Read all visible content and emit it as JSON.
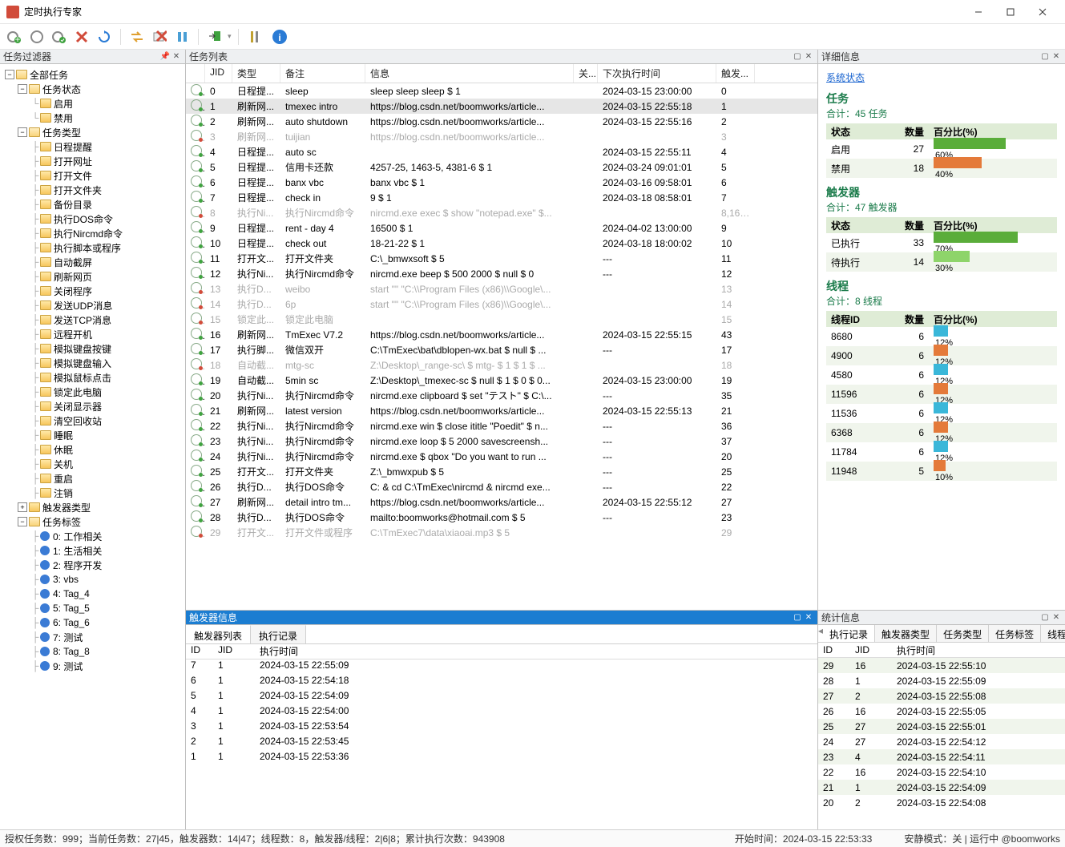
{
  "window": {
    "title": "定时执行专家"
  },
  "toolbar": {
    "info": "i"
  },
  "panels": {
    "filter": "任务过滤器",
    "tasklist": "任务列表",
    "trigger": "触发器信息",
    "detail": "详细信息",
    "stats": "统计信息"
  },
  "trigger_tabs": {
    "list": "触发器列表",
    "log": "执行记录"
  },
  "stats_tabs": [
    "执行记录",
    "触发器类型",
    "任务类型",
    "任务标签",
    "线程"
  ],
  "tree": {
    "root": "全部任务",
    "status_group": "任务状态",
    "status": [
      "启用",
      "禁用"
    ],
    "type_group": "任务类型",
    "types": [
      "日程提醒",
      "打开网址",
      "打开文件",
      "打开文件夹",
      "备份目录",
      "执行DOS命令",
      "执行Nircmd命令",
      "执行脚本或程序",
      "自动截屏",
      "刷新网页",
      "关闭程序",
      "发送UDP消息",
      "发送TCP消息",
      "远程开机",
      "模拟键盘按键",
      "模拟键盘输入",
      "模拟鼠标点击",
      "锁定此电脑",
      "关闭显示器",
      "清空回收站",
      "睡眠",
      "休眠",
      "关机",
      "重启",
      "注销"
    ],
    "trigtype_group": "触发器类型",
    "tag_group": "任务标签",
    "tags": [
      {
        "label": "0: 工作相关",
        "color": "#3a7bd5"
      },
      {
        "label": "1: 生活相关",
        "color": "#3a7bd5"
      },
      {
        "label": "2: 程序开发",
        "color": "#3a7bd5"
      },
      {
        "label": "3: vbs",
        "color": "#3a7bd5"
      },
      {
        "label": "4: Tag_4",
        "color": "#3a7bd5"
      },
      {
        "label": "5: Tag_5",
        "color": "#3a7bd5"
      },
      {
        "label": "6: Tag_6",
        "color": "#3a7bd5"
      },
      {
        "label": "7: 测试",
        "color": "#3a7bd5"
      },
      {
        "label": "8: Tag_8",
        "color": "#3a7bd5"
      },
      {
        "label": "9: 测试",
        "color": "#3a7bd5"
      }
    ]
  },
  "task_cols": {
    "jid": "JID",
    "type": "类型",
    "note": "备注",
    "info": "信息",
    "rel": "关...",
    "next": "下次执行时间",
    "trig": "触发..."
  },
  "tasks": [
    {
      "en": true,
      "jid": 0,
      "type": "日程提...",
      "note": "sleep",
      "info": "sleep sleep sleep $ 1",
      "next": "2024-03-15 23:00:00",
      "trig": "0"
    },
    {
      "en": true,
      "sel": true,
      "jid": 1,
      "type": "刷新网...",
      "note": "tmexec intro",
      "info": "https://blog.csdn.net/boomworks/article...",
      "next": "2024-03-15 22:55:18",
      "trig": "1"
    },
    {
      "en": true,
      "jid": 2,
      "type": "刷新网...",
      "note": "auto shutdown",
      "info": "https://blog.csdn.net/boomworks/article...",
      "next": "2024-03-15 22:55:16",
      "trig": "2"
    },
    {
      "en": false,
      "jid": 3,
      "type": "刷新网...",
      "note": "tuijian",
      "info": "https://blog.csdn.net/boomworks/article...",
      "next": "",
      "trig": "3"
    },
    {
      "en": true,
      "jid": 4,
      "type": "日程提...",
      "note": "auto sc",
      "info": "",
      "next": "2024-03-15 22:55:11",
      "trig": "4"
    },
    {
      "en": true,
      "jid": 5,
      "type": "日程提...",
      "note": "信用卡还款",
      "info": "4257-25, 1463-5, 4381-6 $ 1",
      "next": "2024-03-24 09:01:01",
      "trig": "5"
    },
    {
      "en": true,
      "jid": 6,
      "type": "日程提...",
      "note": "banx vbc",
      "info": "banx vbc $ 1",
      "next": "2024-03-16 09:58:01",
      "trig": "6"
    },
    {
      "en": true,
      "jid": 7,
      "type": "日程提...",
      "note": "check in",
      "info": "9 $ 1",
      "next": "2024-03-18 08:58:01",
      "trig": "7"
    },
    {
      "en": false,
      "jid": 8,
      "type": "执行Ni...",
      "note": "执行Nircmd命令",
      "info": "nircmd.exe exec $ show \"notepad.exe\" $...",
      "next": "",
      "trig": "8,16,..."
    },
    {
      "en": true,
      "jid": 9,
      "type": "日程提...",
      "note": "rent - day 4",
      "info": "16500 $ 1",
      "next": "2024-04-02 13:00:00",
      "trig": "9"
    },
    {
      "en": true,
      "jid": 10,
      "type": "日程提...",
      "note": "check out",
      "info": "18-21-22 $ 1",
      "next": "2024-03-18 18:00:02",
      "trig": "10"
    },
    {
      "en": true,
      "jid": 11,
      "type": "打开文...",
      "note": "打开文件夹",
      "info": "C:\\_bmwxsoft $ 5",
      "next": "---",
      "trig": "11"
    },
    {
      "en": true,
      "jid": 12,
      "type": "执行Ni...",
      "note": "执行Nircmd命令",
      "info": "nircmd.exe beep $ 500 2000 $ null $ 0",
      "next": "---",
      "trig": "12"
    },
    {
      "en": false,
      "jid": 13,
      "type": "执行D...",
      "note": "weibo",
      "info": "start \"\" \"C:\\\\Program Files (x86)\\\\Google\\...",
      "next": "",
      "trig": "13"
    },
    {
      "en": false,
      "jid": 14,
      "type": "执行D...",
      "note": "6p",
      "info": "start \"\" \"C:\\\\Program Files (x86)\\\\Google\\...",
      "next": "",
      "trig": "14"
    },
    {
      "en": false,
      "jid": 15,
      "type": "锁定此...",
      "note": "锁定此电脑",
      "info": "",
      "next": "",
      "trig": "15"
    },
    {
      "en": true,
      "jid": 16,
      "type": "刷新网...",
      "note": "TmExec V7.2",
      "info": "https://blog.csdn.net/boomworks/article...",
      "next": "2024-03-15 22:55:15",
      "trig": "43"
    },
    {
      "en": true,
      "jid": 17,
      "type": "执行脚...",
      "note": "微信双开",
      "info": "C:\\TmExec\\bat\\dblopen-wx.bat $ null $ ...",
      "next": "---",
      "trig": "17"
    },
    {
      "en": false,
      "jid": 18,
      "type": "自动截...",
      "note": "mtg-sc",
      "info": "Z:\\Desktop\\_range-sc\\ $ mtg- $ 1 $ 1 $ ...",
      "next": "",
      "trig": "18"
    },
    {
      "en": true,
      "jid": 19,
      "type": "自动截...",
      "note": "5min sc",
      "info": "Z:\\Desktop\\_tmexec-sc $ null $ 1 $ 0 $ 0...",
      "next": "2024-03-15 23:00:00",
      "trig": "19"
    },
    {
      "en": true,
      "jid": 20,
      "type": "执行Ni...",
      "note": "执行Nircmd命令",
      "info": "nircmd.exe clipboard $ set \"テスト\" $ C:\\...",
      "next": "---",
      "trig": "35"
    },
    {
      "en": true,
      "jid": 21,
      "type": "刷新网...",
      "note": "latest version",
      "info": "https://blog.csdn.net/boomworks/article...",
      "next": "2024-03-15 22:55:13",
      "trig": "21"
    },
    {
      "en": true,
      "jid": 22,
      "type": "执行Ni...",
      "note": "执行Nircmd命令",
      "info": "nircmd.exe win $ close ititle \"Poedit\" $ n...",
      "next": "---",
      "trig": "36"
    },
    {
      "en": true,
      "jid": 23,
      "type": "执行Ni...",
      "note": "执行Nircmd命令",
      "info": "nircmd.exe loop $ 5 2000 savescreensh...",
      "next": "---",
      "trig": "37"
    },
    {
      "en": true,
      "jid": 24,
      "type": "执行Ni...",
      "note": "执行Nircmd命令",
      "info": "nircmd.exe $ qbox \"Do you want to run ...",
      "next": "---",
      "trig": "20"
    },
    {
      "en": true,
      "jid": 25,
      "type": "打开文...",
      "note": "打开文件夹",
      "info": "Z:\\_bmwxpub $ 5",
      "next": "---",
      "trig": "25"
    },
    {
      "en": true,
      "jid": 26,
      "type": "执行D...",
      "note": "执行DOS命令",
      "info": "C: & cd C:\\TmExec\\nircmd & nircmd exe...",
      "next": "---",
      "trig": "22"
    },
    {
      "en": true,
      "jid": 27,
      "type": "刷新网...",
      "note": "detail intro tm...",
      "info": "https://blog.csdn.net/boomworks/article...",
      "next": "2024-03-15 22:55:12",
      "trig": "27"
    },
    {
      "en": true,
      "jid": 28,
      "type": "执行D...",
      "note": "执行DOS命令",
      "info": "mailto:boomworks@hotmail.com $ 5",
      "next": "---",
      "trig": "23"
    },
    {
      "en": false,
      "jid": 29,
      "type": "打开文...",
      "note": "打开文件或程序",
      "info": "C:\\TmExec7\\data\\xiaoai.mp3 $ 5",
      "next": "",
      "trig": "29"
    }
  ],
  "triggers": {
    "cols": {
      "id": "ID",
      "jid": "JID",
      "time": "执行时间"
    },
    "rows": [
      {
        "id": 7,
        "jid": 1,
        "time": "2024-03-15 22:55:09"
      },
      {
        "id": 6,
        "jid": 1,
        "time": "2024-03-15 22:54:18"
      },
      {
        "id": 5,
        "jid": 1,
        "time": "2024-03-15 22:54:09"
      },
      {
        "id": 4,
        "jid": 1,
        "time": "2024-03-15 22:54:00"
      },
      {
        "id": 3,
        "jid": 1,
        "time": "2024-03-15 22:53:54"
      },
      {
        "id": 2,
        "jid": 1,
        "time": "2024-03-15 22:53:45"
      },
      {
        "id": 1,
        "jid": 1,
        "time": "2024-03-15 22:53:36"
      }
    ]
  },
  "detail": {
    "syslink": "系统状态",
    "task_title": "任务",
    "task_total": "合计：45 任务",
    "cols": {
      "state": "状态",
      "count": "数量",
      "pct": "百分比(%)"
    },
    "task_rows": [
      {
        "state": "启用",
        "count": 27,
        "pct": 60,
        "color": "#5aad3a"
      },
      {
        "state": "禁用",
        "count": 18,
        "pct": 40,
        "color": "#e47a3a"
      }
    ],
    "trig_title": "触发器",
    "trig_total": "合计：47 触发器",
    "trig_rows": [
      {
        "state": "已执行",
        "count": 33,
        "pct": 70,
        "color": "#5aad3a"
      },
      {
        "state": "待执行",
        "count": 14,
        "pct": 30,
        "color": "#8ed46a"
      }
    ],
    "thread_title": "线程",
    "thread_total": "合计：8 线程",
    "thread_cols": {
      "id": "线程ID",
      "count": "数量",
      "pct": "百分比(%)"
    },
    "thread_rows": [
      {
        "id": 8680,
        "count": 6,
        "pct": 12,
        "color": "#3ab7d9"
      },
      {
        "id": 4900,
        "count": 6,
        "pct": 12,
        "color": "#e47a3a"
      },
      {
        "id": 4580,
        "count": 6,
        "pct": 12,
        "color": "#3ab7d9"
      },
      {
        "id": 11596,
        "count": 6,
        "pct": 12,
        "color": "#e47a3a"
      },
      {
        "id": 11536,
        "count": 6,
        "pct": 12,
        "color": "#3ab7d9"
      },
      {
        "id": 6368,
        "count": 6,
        "pct": 12,
        "color": "#e47a3a"
      },
      {
        "id": 11784,
        "count": 6,
        "pct": 12,
        "color": "#3ab7d9"
      },
      {
        "id": 11948,
        "count": 5,
        "pct": 10,
        "color": "#e47a3a"
      }
    ]
  },
  "stats_grid": {
    "cols": {
      "id": "ID",
      "jid": "JID",
      "time": "执行时间"
    },
    "rows": [
      {
        "id": 29,
        "jid": 16,
        "time": "2024-03-15 22:55:10"
      },
      {
        "id": 28,
        "jid": 1,
        "time": "2024-03-15 22:55:09"
      },
      {
        "id": 27,
        "jid": 2,
        "time": "2024-03-15 22:55:08"
      },
      {
        "id": 26,
        "jid": 16,
        "time": "2024-03-15 22:55:05"
      },
      {
        "id": 25,
        "jid": 27,
        "time": "2024-03-15 22:55:01"
      },
      {
        "id": 24,
        "jid": 27,
        "time": "2024-03-15 22:54:12"
      },
      {
        "id": 23,
        "jid": 4,
        "time": "2024-03-15 22:54:11"
      },
      {
        "id": 22,
        "jid": 16,
        "time": "2024-03-15 22:54:10"
      },
      {
        "id": 21,
        "jid": 1,
        "time": "2024-03-15 22:54:09"
      },
      {
        "id": 20,
        "jid": 2,
        "time": "2024-03-15 22:54:08"
      }
    ]
  },
  "statusbar": {
    "left": "授权任务数：999；当前任务数：27|45，触发器数：14|47；线程数：8，触发器/线程：2|6|8；累计执行次数：943908",
    "mid": "开始时间：2024-03-15 22:53:33",
    "right": "安静模式：关 | 运行中  @boomworks"
  }
}
